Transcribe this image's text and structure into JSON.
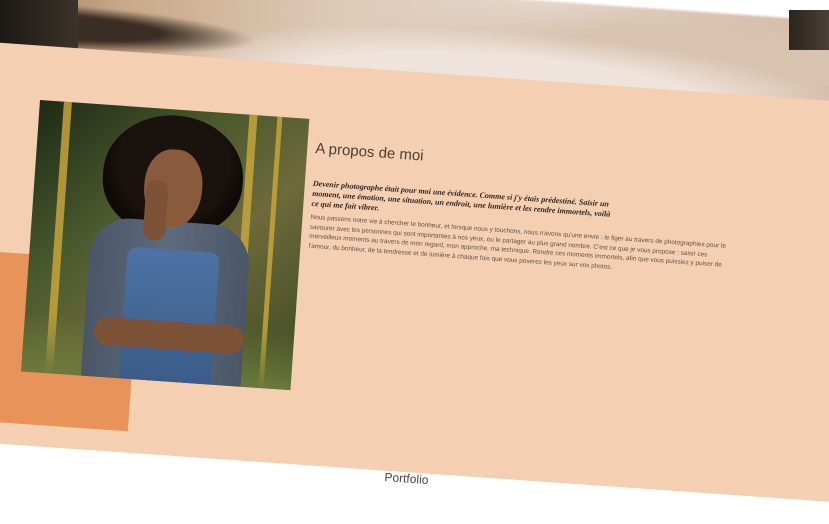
{
  "hero": {
    "slides": [
      {
        "active": false
      },
      {
        "active": false
      },
      {
        "active": true
      }
    ]
  },
  "about": {
    "title": "A propos de moi",
    "lead": "Devenir photographe était pour moi une évidence. Comme si j'y étais prédestiné. Saisir un moment, une émotion, une situation, un endroit, une lumière et les rendre immortels, voilà ce qui me fait vibrer.",
    "body": "Nous passons notre vie à chercher le bonheur, et lorsque nous y touchons, nous n'avons qu'une envie : le figer au travers de photographies pour le savourer avec les personnes qui sont importantes à nos yeux, ou le partager au plus grand nombre. C'est ce que je vous propose : saisir ces merveilleux moments au travers de mon regard, mon approche, ma technique. Rendre ces moments immortels, afin que vous puissiez y puiser de l'amour, du bonheur, de la tendresse et de lumière à chaque fois que vous poserez les yeux sur vos photos.",
    "accent_color": "#f5cfb2",
    "block_color": "#e8935a"
  },
  "portfolio": {
    "label": "Portfolio"
  }
}
